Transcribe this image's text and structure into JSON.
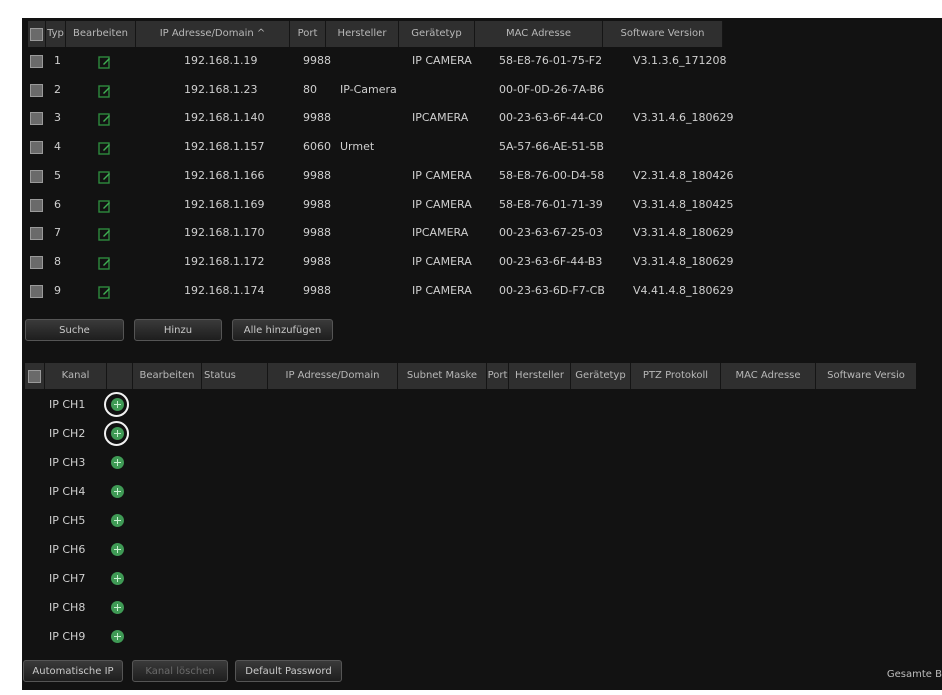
{
  "top_table": {
    "headers": [
      "Typ",
      "Bearbeiten",
      "IP Adresse/Domain ^",
      "Port",
      "Hersteller",
      "Gerätetyp",
      "MAC Adresse",
      "Software Version"
    ],
    "rows": [
      {
        "num": "1",
        "ip": "192.168.1.19",
        "port": "9988",
        "manu": "",
        "type": "IP CAMERA",
        "mac": "58-E8-76-01-75-F2",
        "sw": "V3.1.3.6_171208"
      },
      {
        "num": "2",
        "ip": "192.168.1.23",
        "port": "80",
        "manu": "IP-Camera",
        "type": "",
        "mac": "00-0F-0D-26-7A-B6",
        "sw": ""
      },
      {
        "num": "3",
        "ip": "192.168.1.140",
        "port": "9988",
        "manu": "",
        "type": "IPCAMERA",
        "mac": "00-23-63-6F-44-C0",
        "sw": "V3.31.4.6_180629"
      },
      {
        "num": "4",
        "ip": "192.168.1.157",
        "port": "6060",
        "manu": "Urmet",
        "type": "",
        "mac": "5A-57-66-AE-51-5B",
        "sw": ""
      },
      {
        "num": "5",
        "ip": "192.168.1.166",
        "port": "9988",
        "manu": "",
        "type": "IP CAMERA",
        "mac": "58-E8-76-00-D4-58",
        "sw": "V2.31.4.8_180426"
      },
      {
        "num": "6",
        "ip": "192.168.1.169",
        "port": "9988",
        "manu": "",
        "type": "IP CAMERA",
        "mac": "58-E8-76-01-71-39",
        "sw": "V3.31.4.8_180425"
      },
      {
        "num": "7",
        "ip": "192.168.1.170",
        "port": "9988",
        "manu": "",
        "type": "IPCAMERA",
        "mac": "00-23-63-67-25-03",
        "sw": "V3.31.4.8_180629"
      },
      {
        "num": "8",
        "ip": "192.168.1.172",
        "port": "9988",
        "manu": "",
        "type": "IP CAMERA",
        "mac": "00-23-63-6F-44-B3",
        "sw": "V3.31.4.8_180629"
      },
      {
        "num": "9",
        "ip": "192.168.1.174",
        "port": "9988",
        "manu": "",
        "type": "IP CAMERA",
        "mac": "00-23-63-6D-F7-CB",
        "sw": "V4.41.4.8_180629"
      }
    ]
  },
  "top_buttons": {
    "search": "Suche",
    "add": "Hinzu",
    "add_all": "Alle hinzufügen"
  },
  "bottom_table": {
    "headers": [
      "Kanal",
      "",
      "Bearbeiten",
      "Status",
      "IP Adresse/Domain",
      "Subnet Maske",
      "Port",
      "Hersteller",
      "Gerätetyp",
      "PTZ Protokoll",
      "MAC Adresse",
      "Software Versio"
    ],
    "channels": [
      "IP CH1",
      "IP CH2",
      "IP CH3",
      "IP CH4",
      "IP CH5",
      "IP CH6",
      "IP CH7",
      "IP CH8",
      "IP CH9"
    ]
  },
  "bottom_buttons": {
    "auto_ip": "Automatische IP",
    "delete_channel": "Kanal löschen",
    "default_password": "Default Password"
  },
  "total_label": "Gesamte B",
  "colors": {
    "background": "#121212",
    "header": "#2f2f2f",
    "add_icon": "#3f9a55",
    "edit_icon": "#2e8b3e"
  }
}
